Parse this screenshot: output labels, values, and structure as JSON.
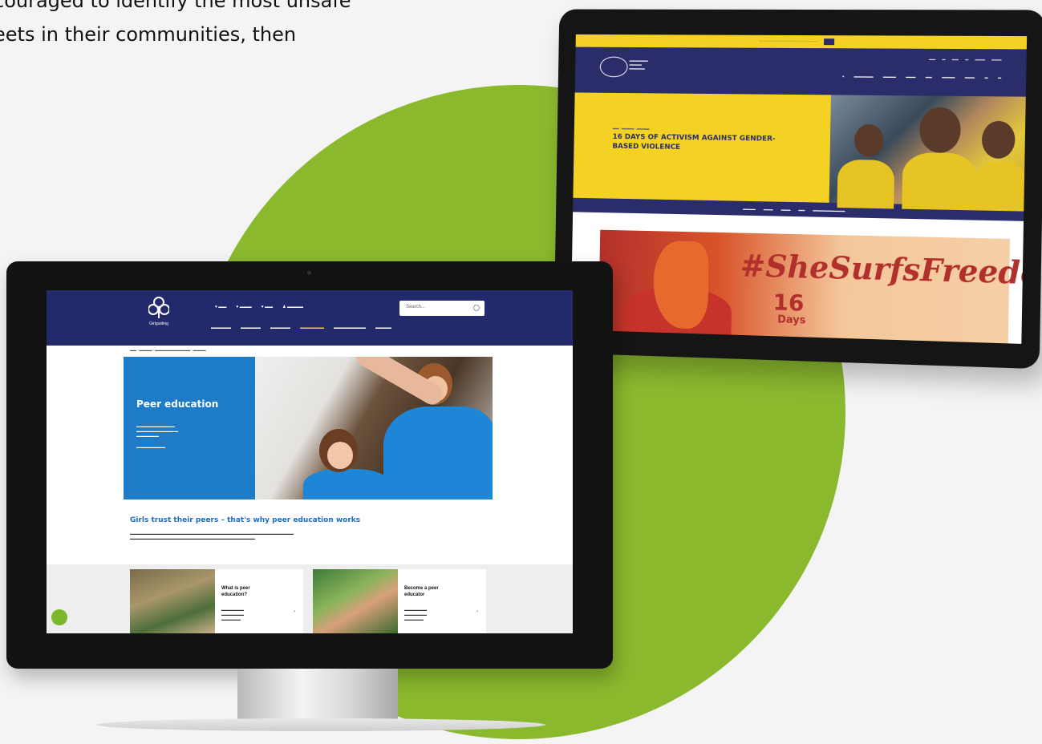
{
  "intro_text": {
    "line1": "couraged to identify the most unsafe",
    "line2": "eets in their communities, then"
  },
  "colors": {
    "accent_green": "#8ab92e",
    "girlguiding_navy": "#232a6b",
    "wagggs_yellow": "#f3d224",
    "peer_blue": "#1d7bc8"
  },
  "tablet": {
    "hero_title": "16 DAYS OF ACTIVISM AGAINST GENDER-BASED VIOLENCE",
    "banner_hashtag": "#SheSurfsFreedom",
    "banner_number": "16",
    "banner_unit": "Days"
  },
  "monitor": {
    "brand": "Girlguiding",
    "search_placeholder": "Search...",
    "hero_title": "Peer education",
    "section_heading": "Girls trust their peers – that's why peer education works",
    "cards": [
      {
        "title": "What is peer education?"
      },
      {
        "title": "Become a peer educator"
      }
    ]
  }
}
